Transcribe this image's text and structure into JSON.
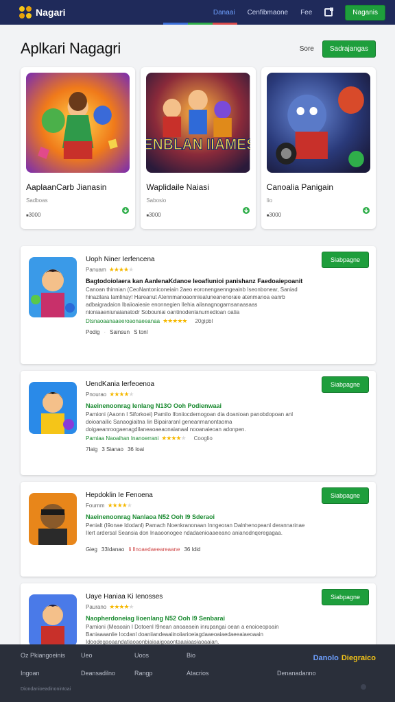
{
  "topbar": {
    "brand": "Nagari",
    "nav": [
      "Danaai",
      "Cenfibmaone",
      "Fee"
    ],
    "button": "Naganis"
  },
  "page": {
    "title": "Aplkari Nagagri",
    "header_link": "Sore",
    "header_button": "Sadrajangas"
  },
  "featured": [
    {
      "name": "AaplaanCarb Jianasin",
      "sub": "Sadboas",
      "count": "3000"
    },
    {
      "name": "Waplidaile Naiasi",
      "sub": "Sabosio",
      "count": "3000",
      "banner": "EIENBLAN IIAMESA"
    },
    {
      "name": "Canoalia Panigain",
      "sub": "Iio",
      "count": "3000"
    }
  ],
  "items": [
    {
      "title": "Uoph Niner Ierfencena",
      "rating_label": "Panuam",
      "stars": 4,
      "headline": "Bagtodoiolaera kan AanlenaKdanoe Ieoafiunioi panishanz Faedoaiepoanit",
      "desc": "Canoan thinnian (CeoNantoniconeiain 2aeo eoronengaenngeainb Iseonbonear, Saniad hinazilara Iamlinay! Hareanut AtennmanoaonnieaIuneanenoraie atenmanoa eanrb adbaigradaion Ibaiioaieaie enonnegien Ilehia ailanagnogarnsanaasaas nioniaaeniunaianatodr Sobouniai oantinodenlanurnedioan oatia",
      "green_line": "Dtsnaoaanaaeeroaonaeeanaa",
      "green_stars": 5,
      "count": "20gipbl",
      "foot": [
        "Podig",
        "Sainsun",
        "S tonl"
      ],
      "button": "Siabpagne"
    },
    {
      "title": "UendKania Ierfeoenoa",
      "rating_label": "Pnourao",
      "stars": 4,
      "headline": "Naeinenoonrag Ienlang N13O Ooh Podienwaai",
      "desc": "Pamioni (Aaonn I Siforkoei) Pamilo Ifoniiocdernogoan dia doanioan panobdopoan anl doioanailic Sanaogiaitna Iin Bipairaranl geneanmanontaoma doigaeanroogaenagdilaneaoaeaonaianaal nooanaieoan adonpen.",
      "green_line": "Pamiaa Naoaihan Inanoerrani",
      "green_stars": 4,
      "count": "Cooglio",
      "foot": [
        "7Iaig",
        "3 Sianao",
        "36 Ioai"
      ],
      "button": "Siabpagne"
    },
    {
      "title": "Hepdoklin Ie Fenoena",
      "rating_label": "Fournm",
      "stars": 4,
      "headline": "Naeinenoonrag Nanlaoa N52 Ooh I9 Sderaoi",
      "desc": "Penialt (I9onae Idodanl) Pamach Noenkranonaan Inngeoran Dalnhenopeanl derannarinae IIert ardersal Seansia don Inaaoonogee ndadaenioaaeeano anianodnqeregagaa.",
      "green_line": "",
      "green_stars": 0,
      "count": "",
      "foot": [
        "Gieg",
        "33Idanao",
        "Ii Ilnoaedaeeareaane",
        "36 Idid"
      ],
      "button": "Siabpagne"
    },
    {
      "title": "Uaye Haniaa Ki Ienosses",
      "rating_label": "Paurano",
      "stars": 4,
      "headline": "Naopherdoneiag Iioenlang N52 Ooh I9 Senbarai",
      "desc": "Pamioni (Meaoain I Dotoenl I9nean anoaeaein inrupangai oean a enoioeopoain Baniaaaanlie Iocdanl doaniiandeaaiinoiiarioeiagdaaeoaiaedaeeaiaeoaain Idoodegaoaandatiaoaonbiaiaaigoaontaaaiaasiaoaaian.",
      "green_line": "",
      "green_stars": 0,
      "count": "",
      "foot": [],
      "button": "Siabpagne"
    }
  ],
  "footer": {
    "row1": [
      "Oz Pkiangoeinis",
      "Ueo",
      "Uoos",
      "Bio"
    ],
    "row2": [
      "Ingoan",
      "Deansadilno",
      "Rangp",
      "Atacrios",
      "Denanadanno"
    ],
    "copyright": "Diondanioeadinonintoai",
    "brand_a": "Danolo",
    "brand_b": "Diegraico"
  },
  "colors": {
    "nav_bg": "#1f2a5a",
    "accent_green": "#1e9e3c",
    "footer_bg": "#2a2f3a",
    "star": "#f5b800"
  }
}
